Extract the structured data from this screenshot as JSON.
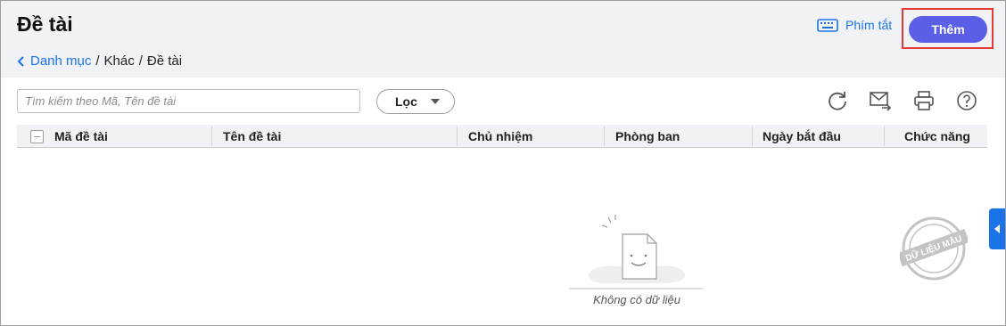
{
  "header": {
    "title": "Đề tài",
    "breadcrumb": {
      "back_label": "Danh mục",
      "items": [
        "Khác",
        "Đề tài"
      ]
    },
    "shortcut_label": "Phím tắt",
    "add_label": "Thêm"
  },
  "toolbar": {
    "search_placeholder": "Tìm kiếm theo Mã, Tên đề tài",
    "filter_label": "Lọc",
    "icons": [
      "refresh-icon",
      "send-email-icon",
      "print-icon",
      "help-icon"
    ]
  },
  "table": {
    "columns": [
      "Mã đề tài",
      "Tên đề tài",
      "Chủ nhiệm",
      "Phòng ban",
      "Ngày bắt đầu",
      "Chức năng"
    ],
    "rows": [],
    "empty_text": "Không có dữ liệu"
  },
  "watermark": {
    "text": "DỮ LIỆU MẪU"
  },
  "colors": {
    "accent": "#1a73e8",
    "primary_button": "#5b5ee6",
    "highlight_box": "#e53935",
    "header_bg": "#f1f2f6"
  }
}
